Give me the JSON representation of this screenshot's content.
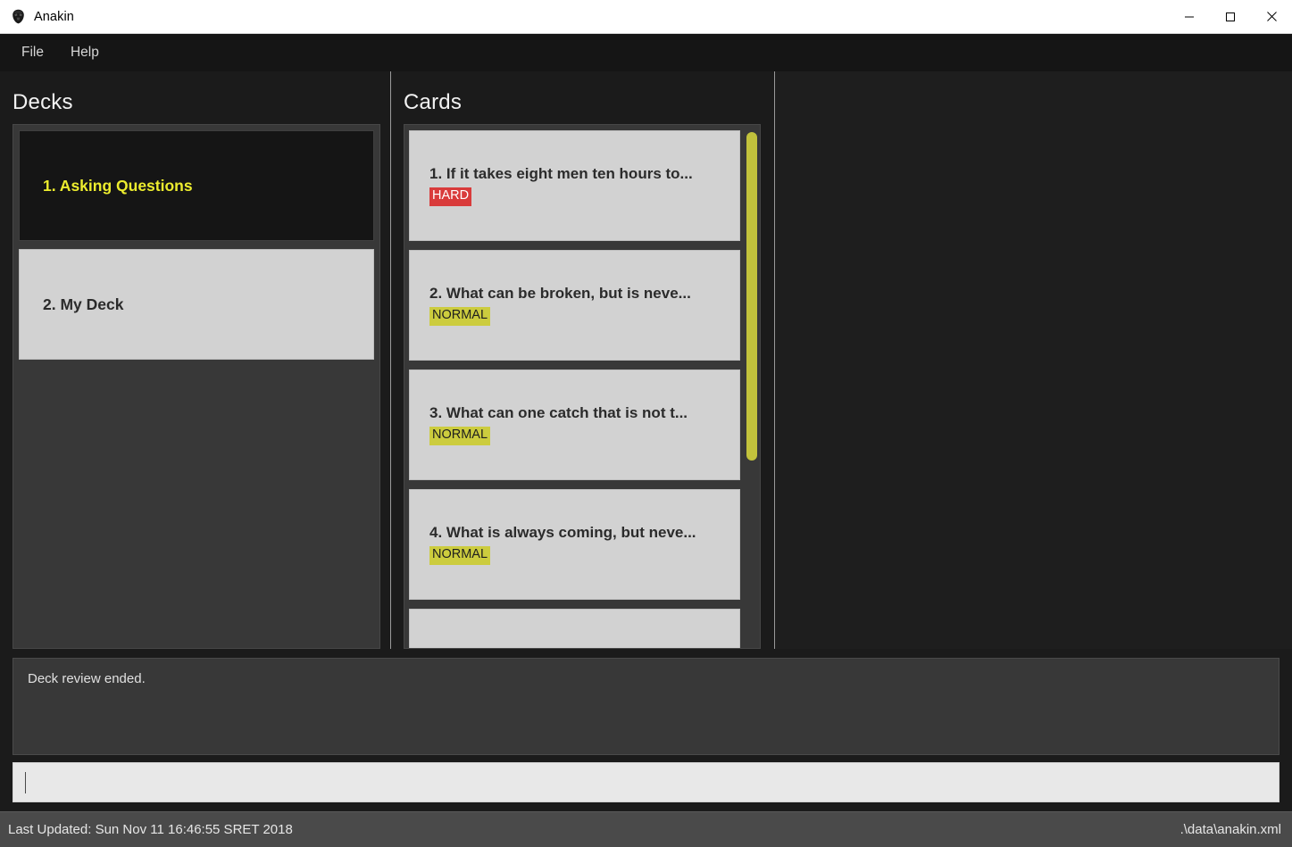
{
  "window": {
    "title": "Anakin",
    "icon": "darth-vader-helmet-icon",
    "minimize_label": "—",
    "maximize_label": "☐",
    "close_label": "✕"
  },
  "menubar": {
    "items": [
      {
        "label": "File"
      },
      {
        "label": "Help"
      }
    ]
  },
  "decks_pane": {
    "title": "Decks",
    "items": [
      {
        "label": "1.  Asking Questions",
        "selected": true
      },
      {
        "label": "2.  My Deck",
        "selected": false
      }
    ]
  },
  "cards_pane": {
    "title": "Cards",
    "items": [
      {
        "label": "1.   If it takes eight men ten hours to...",
        "badge": "HARD",
        "badge_type": "hard"
      },
      {
        "label": "2.   What can be broken, but is neve...",
        "badge": "NORMAL",
        "badge_type": "normal"
      },
      {
        "label": "3.   What can one catch that is not t...",
        "badge": "NORMAL",
        "badge_type": "normal"
      },
      {
        "label": "4.   What is always coming, but neve...",
        "badge": "NORMAL",
        "badge_type": "normal"
      },
      {
        "label": "",
        "badge": "",
        "badge_type": "none"
      }
    ]
  },
  "console": {
    "output_line": "Deck review ended.",
    "input_value": "",
    "input_placeholder": ""
  },
  "statusbar": {
    "left_text": "Last Updated: Sun Nov 11 16:46:55 SRET 2018",
    "right_text": ".\\data\\anakin.xml"
  },
  "colors": {
    "accent_yellow": "#ecec2e",
    "badge_hard": "#d93b3b",
    "badge_normal": "#cccc3e",
    "scrollbar": "#c2c23c",
    "panel_bg": "#383838",
    "card_bg": "#d2d2d2",
    "window_bg": "#1b1b1b"
  }
}
